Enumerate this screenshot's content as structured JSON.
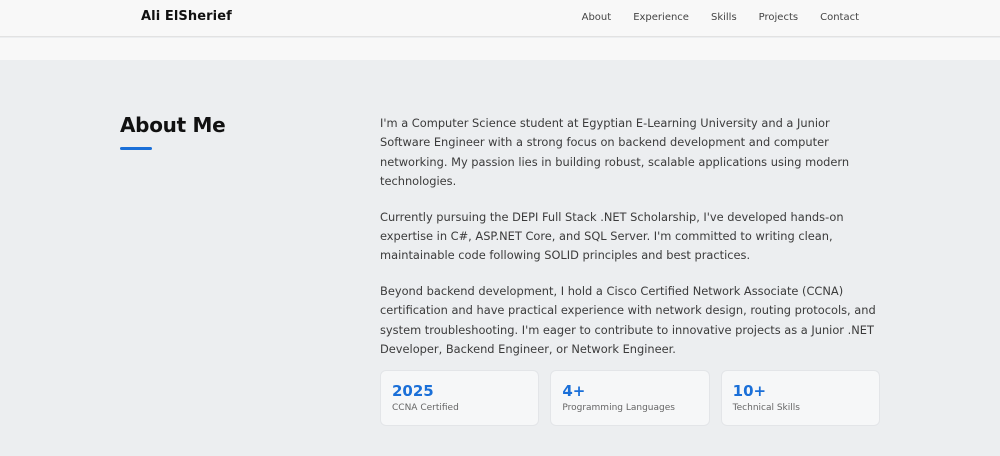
{
  "header": {
    "brand": "Ali ElSherief",
    "nav": [
      {
        "label": "About"
      },
      {
        "label": "Experience"
      },
      {
        "label": "Skills"
      },
      {
        "label": "Projects"
      },
      {
        "label": "Contact"
      }
    ]
  },
  "about": {
    "title": "About Me",
    "paragraphs": [
      "I'm a Computer Science student at Egyptian E-Learning University and a Junior Software Engineer with a strong focus on backend development and computer networking. My passion lies in building robust, scalable applications using modern technologies.",
      "Currently pursuing the DEPI Full Stack .NET Scholarship, I've developed hands-on expertise in C#, ASP.NET Core, and SQL Server. I'm committed to writing clean, maintainable code following SOLID principles and best practices.",
      "Beyond backend development, I hold a Cisco Certified Network Associate (CCNA) certification and have practical experience with network design, routing protocols, and system troubleshooting. I'm eager to contribute to innovative projects as a Junior .NET Developer, Backend Engineer, or Network Engineer."
    ],
    "stats": [
      {
        "value": "2025",
        "label": "CCNA Certified"
      },
      {
        "value": "4+",
        "label": "Programming Languages"
      },
      {
        "value": "10+",
        "label": "Technical Skills"
      }
    ]
  },
  "colors": {
    "accent": "#1a6fd8",
    "page_background": "#eceef0",
    "header_background": "#f8f8f8"
  }
}
